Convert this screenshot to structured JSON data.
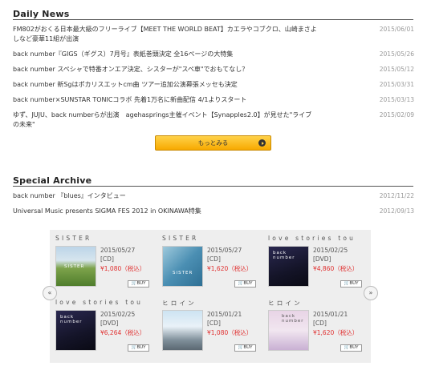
{
  "daily_news": {
    "title": "Daily News",
    "items": [
      {
        "title": "FM802がおくる日本最大級のフリーライブ【MEET THE WORLD BEAT】カエラやコブクロ、山崎まさよしなど豪華11組が出演",
        "date": "2015/06/01"
      },
      {
        "title": "back number『GIGS（ギグス）7月号』表紙巻頭決定 全16ページの大特集",
        "date": "2015/05/26"
      },
      {
        "title": "back number スペシャで特番オンエア決定、シスターが\"スペ車\"でおもてなし？",
        "date": "2015/05/12"
      },
      {
        "title": "back number 新Sgはポカリスエットcm曲 ツアー追加公演幕張メッセも決定",
        "date": "2015/03/31"
      },
      {
        "title": "back number×SUNSTAR TONICコラボ 先着1万名に新曲配信 4/1よりスタート",
        "date": "2015/03/13"
      },
      {
        "title": "ゆず、JUJU、back numberらが出演　agehasprings主催イベント【Synapples2.0】が見せた\"ライブの未来\"",
        "date": "2015/02/09"
      }
    ],
    "more_label": "もっとみる"
  },
  "special_archive": {
    "title": "Special Archive",
    "items": [
      {
        "title": "back number 『blues』インタビュー",
        "date": "2012/11/22"
      },
      {
        "title": "Universal Music presents SIGMA FES 2012 in OKINAWA特集",
        "date": "2012/09/13"
      }
    ]
  },
  "carousel": {
    "prev_label": "«",
    "next_label": "»",
    "products": [
      {
        "artist": "SISTER",
        "date": "2015/05/27",
        "format": "[CD]",
        "price": "¥1,080（税込）",
        "buy": "BUY",
        "cover": "c-sister",
        "cover_text": "SISTER"
      },
      {
        "artist": "SISTER",
        "date": "2015/05/27",
        "format": "[CD]",
        "price": "¥1,620（税込）",
        "buy": "BUY",
        "cover": "c-sister2",
        "cover_text": "SISTER"
      },
      {
        "artist": "love stories tou",
        "date": "2015/02/25",
        "format": "[DVD]",
        "price": "¥4,860（税込）",
        "buy": "BUY",
        "cover": "c-love",
        "cover_text": "back number"
      },
      {
        "artist": "love stories tou",
        "date": "2015/02/25",
        "format": "[DVD]",
        "price": "¥6,264（税込）",
        "buy": "BUY",
        "cover": "c-love",
        "cover_text": "back number"
      },
      {
        "artist": "ヒロイン",
        "date": "2015/01/21",
        "format": "[CD]",
        "price": "¥1,080（税込）",
        "buy": "BUY",
        "cover": "c-heroine",
        "cover_text": ""
      },
      {
        "artist": "ヒロイン",
        "date": "2015/01/21",
        "format": "[CD]",
        "price": "¥1,620（税込）",
        "buy": "BUY",
        "cover": "c-heroine2",
        "cover_text": "back number"
      }
    ]
  }
}
